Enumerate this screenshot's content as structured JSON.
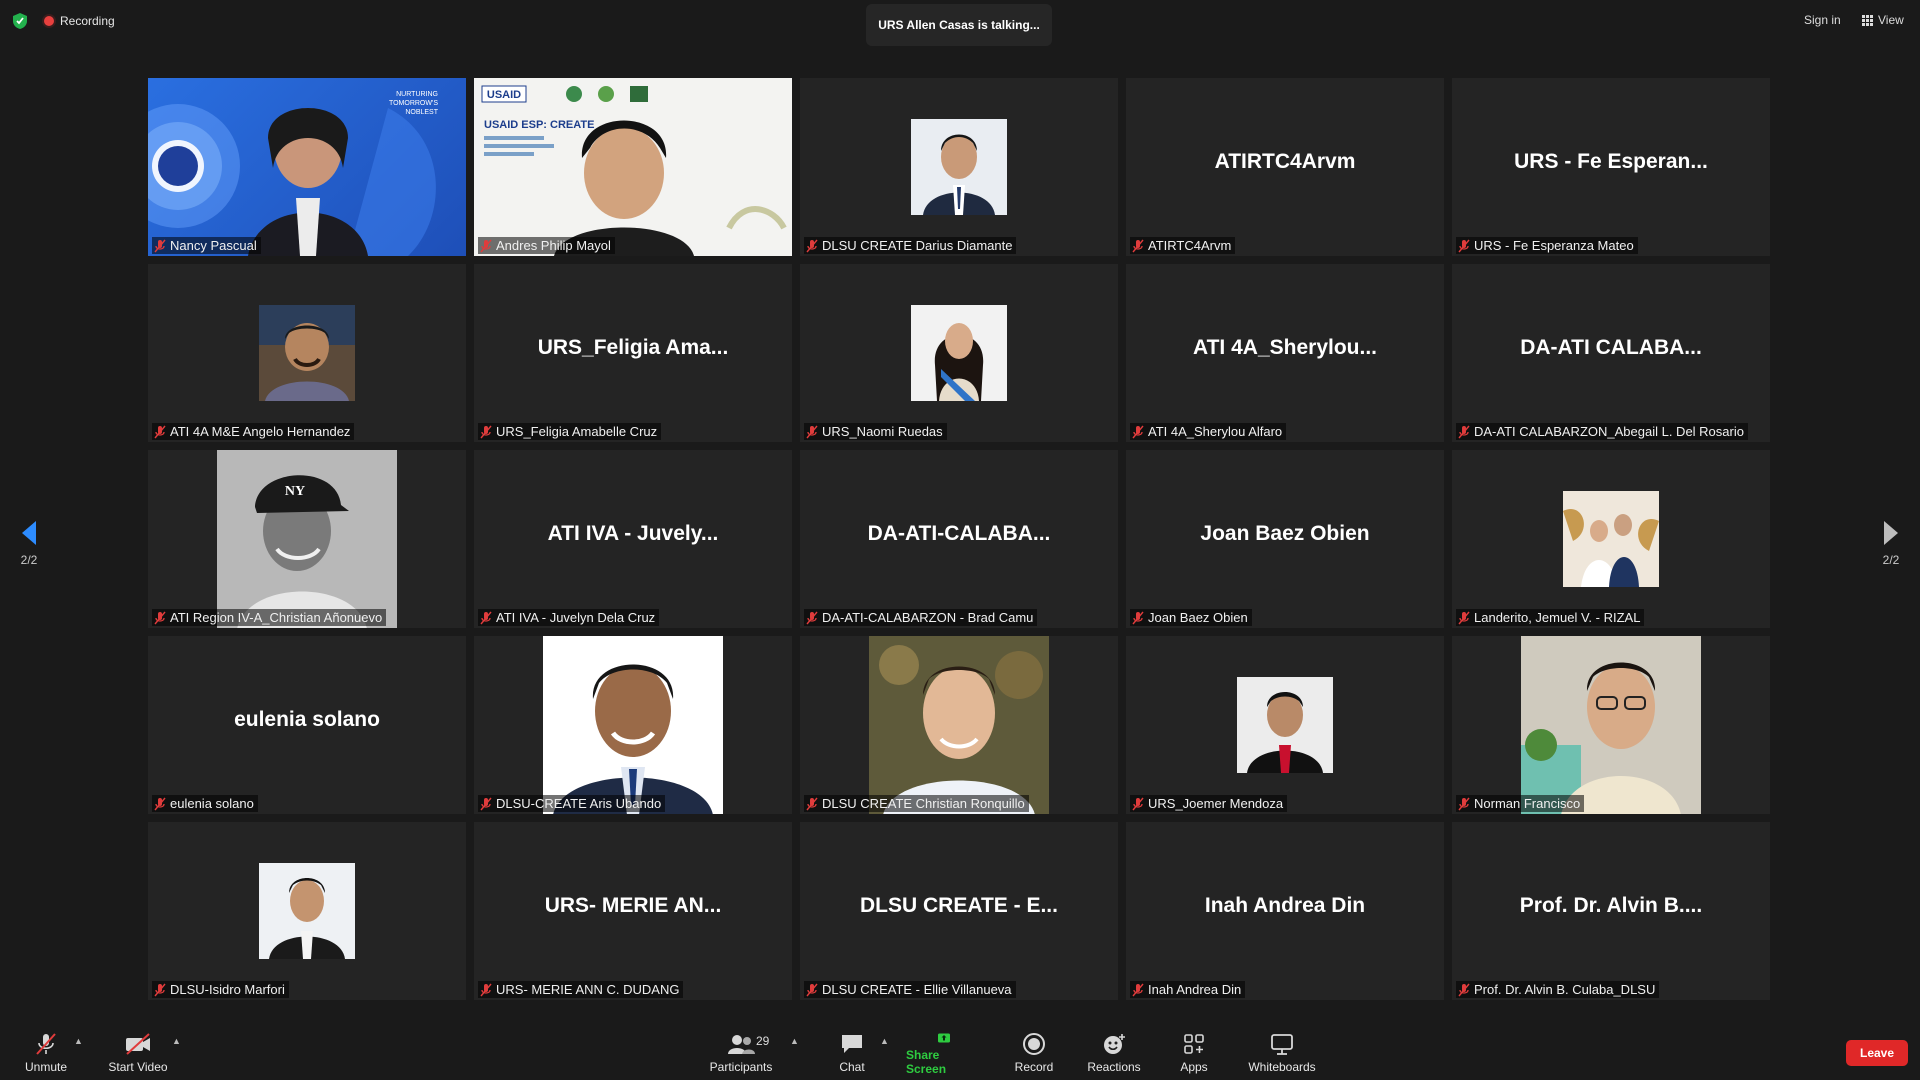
{
  "top": {
    "recording_label": "Recording",
    "talking_indicator": "URS Allen Casas is talking...",
    "sign_in": "Sign in",
    "view": "View"
  },
  "navigation": {
    "left_page": "2/2",
    "right_page": "2/2"
  },
  "tiles": [
    {
      "display": "",
      "label": "Nancy Pascual",
      "kind": "video"
    },
    {
      "display": "",
      "label": "Andres Philip Mayol",
      "kind": "video",
      "slide_text": "USAID ESP: CREATE"
    },
    {
      "display": "",
      "label": "DLSU CREATE Darius Diamante",
      "kind": "photo"
    },
    {
      "display": "ATIRTC4Arvm",
      "label": "ATIRTC4Arvm",
      "kind": "name"
    },
    {
      "display": "URS - Fe Esperan...",
      "label": "URS - Fe Esperanza Mateo",
      "kind": "name"
    },
    {
      "display": "",
      "label": "ATI 4A M&E Angelo Hernandez",
      "kind": "photo"
    },
    {
      "display": "URS_Feligia  Ama...",
      "label": "URS_Feligia Amabelle Cruz",
      "kind": "name"
    },
    {
      "display": "",
      "label": "URS_Naomi Ruedas",
      "kind": "photo"
    },
    {
      "display": "ATI  4A_Sherylou...",
      "label": "ATI 4A_Sherylou Alfaro",
      "kind": "name"
    },
    {
      "display": "DA-ATI  CALABA...",
      "label": "DA-ATI CALABARZON_Abegail L. Del Rosario",
      "kind": "name"
    },
    {
      "display": "",
      "label": "ATI Region IV-A_Christian Añonuevo",
      "kind": "photo-big"
    },
    {
      "display": "ATI IVA - Juvely...",
      "label": "ATI IVA - Juvelyn Dela Cruz",
      "kind": "name"
    },
    {
      "display": "DA-ATI-CALABA...",
      "label": "DA-ATI-CALABARZON - Brad Camu",
      "kind": "name"
    },
    {
      "display": "Joan Baez Obien",
      "label": "Joan Baez Obien",
      "kind": "name"
    },
    {
      "display": "",
      "label": "Landerito, Jemuel V. - RIZAL",
      "kind": "photo"
    },
    {
      "display": "eulenia solano",
      "label": "eulenia solano",
      "kind": "name"
    },
    {
      "display": "",
      "label": "DLSU-CREATE Aris Ubando",
      "kind": "photo-big"
    },
    {
      "display": "",
      "label": "DLSU CREATE Christian Ronquillo",
      "kind": "photo-big"
    },
    {
      "display": "",
      "label": "URS_Joemer Mendoza",
      "kind": "photo"
    },
    {
      "display": "",
      "label": "Norman Francisco",
      "kind": "photo-big"
    },
    {
      "display": "",
      "label": "DLSU-Isidro Marfori",
      "kind": "photo"
    },
    {
      "display": "URS- MERIE AN...",
      "label": "URS- MERIE ANN C. DUDANG",
      "kind": "name"
    },
    {
      "display": "DLSU CREATE - E...",
      "label": "DLSU CREATE - Ellie Villanueva",
      "kind": "name"
    },
    {
      "display": "Inah Andrea Din",
      "label": "Inah Andrea Din",
      "kind": "name"
    },
    {
      "display": "Prof. Dr. Alvin B....",
      "label": "Prof. Dr. Alvin B. Culaba_DLSU",
      "kind": "name"
    }
  ],
  "toolbar": {
    "unmute": "Unmute",
    "start_video": "Start Video",
    "participants_count": "29",
    "participants": "Participants",
    "chat": "Chat",
    "share_screen": "Share Screen",
    "record": "Record",
    "reactions": "Reactions",
    "apps": "Apps",
    "whiteboards": "Whiteboards",
    "leave": "Leave"
  },
  "colors": {
    "background": "#1a1a1a",
    "tile": "#242424",
    "recording": "#e8403e",
    "share_screen": "#2ecc40",
    "leave": "#e02828",
    "nav_arrow": "#2d8cff"
  }
}
